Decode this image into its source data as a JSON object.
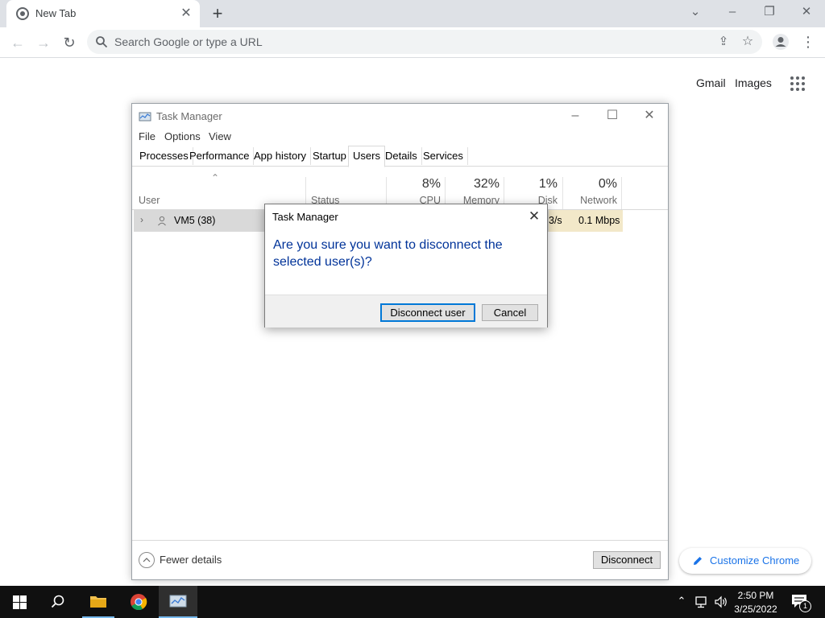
{
  "browser": {
    "tab_title": "New Tab",
    "omnibox_placeholder": "Search Google or type a URL",
    "links": {
      "gmail": "Gmail",
      "images": "Images"
    },
    "customize_label": "Customize Chrome"
  },
  "task_manager": {
    "title": "Task Manager",
    "menu": [
      "File",
      "Options",
      "View"
    ],
    "tabs": [
      "Processes",
      "Performance",
      "App history",
      "Startup",
      "Users",
      "Details",
      "Services"
    ],
    "active_tab": "Users",
    "columns": {
      "user": "User",
      "status": "Status",
      "cpu": {
        "pct": "8%",
        "label": "CPU"
      },
      "memory": {
        "pct": "32%",
        "label": "Memory"
      },
      "disk": {
        "pct": "1%",
        "label": "Disk"
      },
      "network": {
        "pct": "0%",
        "label": "Network"
      }
    },
    "row": {
      "user": "VM5 (38)",
      "disk_tail": "3/s",
      "network": "0.1 Mbps"
    },
    "fewer_details": "Fewer details",
    "disconnect_button": "Disconnect"
  },
  "dialog": {
    "title": "Task Manager",
    "message": "Are you sure you want to disconnect the selected user(s)?",
    "ok_label": "Disconnect user",
    "cancel_label": "Cancel"
  },
  "taskbar": {
    "time": "2:50 PM",
    "date": "3/25/2022",
    "notification_count": "1"
  },
  "colors": {
    "dialog_message": "#003399",
    "chrome_accent": "#1a73e8",
    "focus_border": "#0078d7"
  }
}
